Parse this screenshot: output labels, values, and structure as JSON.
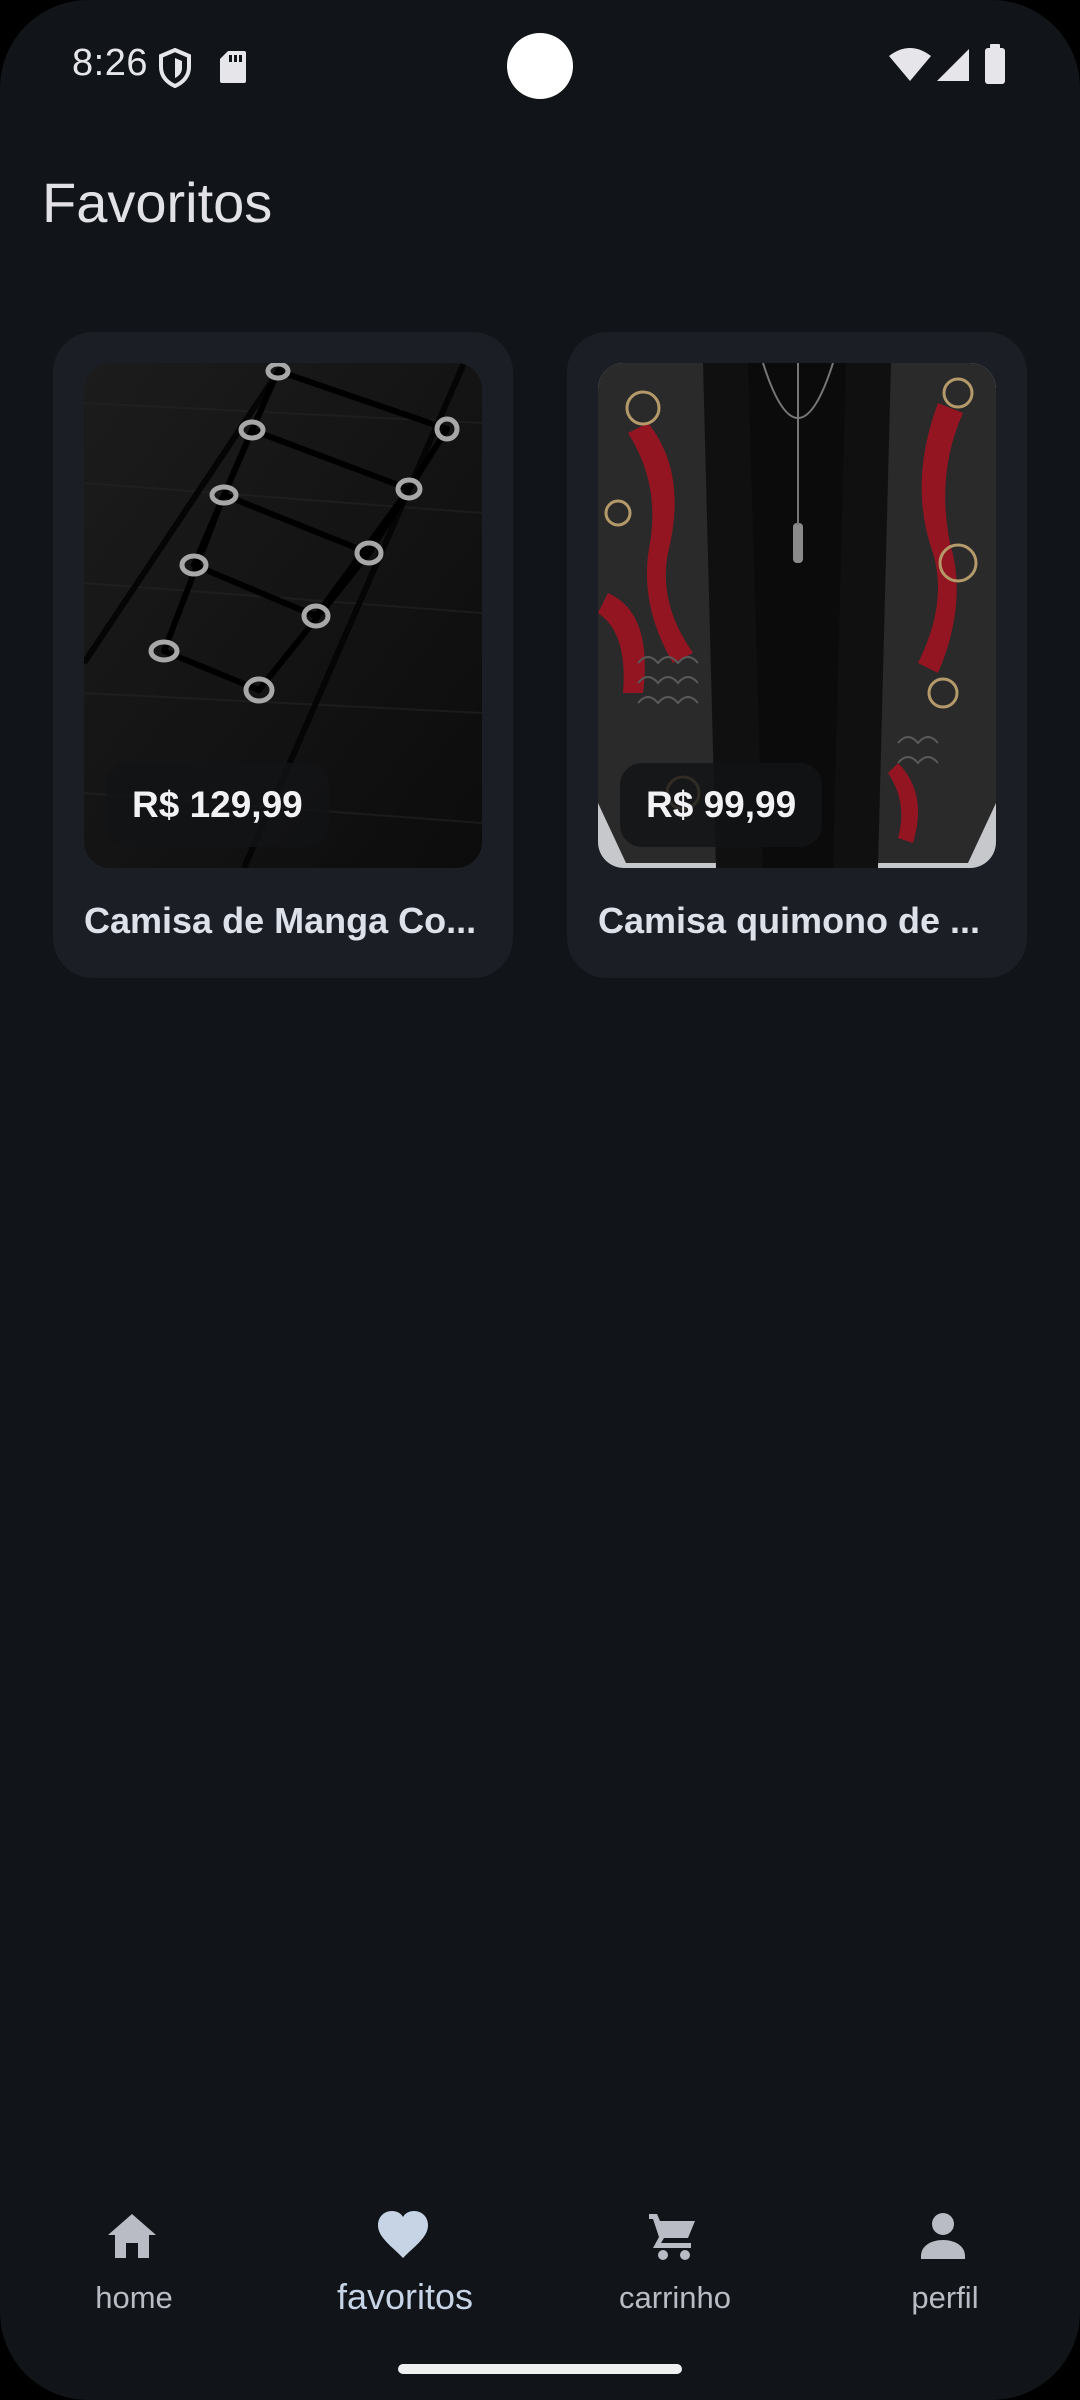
{
  "status_bar": {
    "time": "8:26",
    "icons": [
      "shield-icon",
      "sd-card-icon",
      "wifi-icon",
      "cellular-signal-icon",
      "battery-icon"
    ]
  },
  "page": {
    "title": "Favoritos"
  },
  "favorites": [
    {
      "price": "R$ 129,99",
      "name": "Camisa de Manga Co...",
      "image": "black lace-up shirt with metal eyelets"
    },
    {
      "price": "R$ 99,99",
      "name": "Camisa quimono de ...",
      "image": "black kimono shirt with red floral print"
    }
  ],
  "bottom_nav": {
    "items": [
      {
        "label": "home",
        "icon": "home-icon",
        "active": false
      },
      {
        "label": "favoritos",
        "icon": "heart-icon",
        "active": true
      },
      {
        "label": "carrinho",
        "icon": "cart-icon",
        "active": false
      },
      {
        "label": "perfil",
        "icon": "person-icon",
        "active": false
      }
    ]
  },
  "colors": {
    "background": "#111418",
    "card": "#1b1e24",
    "active_nav": "#c6d4e6",
    "inactive_nav": "#b9bcc4"
  }
}
